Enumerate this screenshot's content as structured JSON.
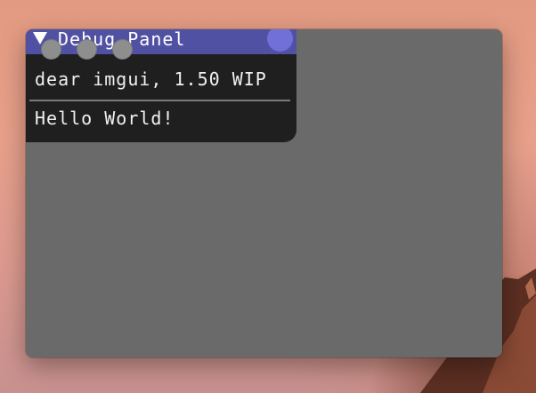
{
  "window": {
    "traffic_lights": [
      "close",
      "minimize",
      "zoom"
    ]
  },
  "debug_panel": {
    "title": "Debug Panel",
    "version_text": "dear imgui, 1.50 WIP",
    "hello_text": "Hello World!"
  },
  "colors": {
    "titlebar": "#5151a3",
    "close_button": "#7070d8",
    "panel_bg": "#1f1f1f",
    "host_bg": "#6a6a6a",
    "traffic_light": "#8e8e8e"
  }
}
